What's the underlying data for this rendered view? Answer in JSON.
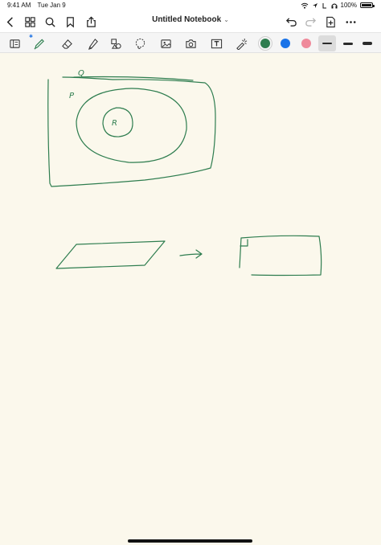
{
  "status_bar": {
    "time": "9:41 AM",
    "date": "Tue Jan 9",
    "battery": "100%",
    "battery_level": 1.0
  },
  "nav": {
    "title": "Untitled Notebook",
    "title_chevron": "⌄",
    "left_icons": [
      "back-icon",
      "grid-icon",
      "search-icon",
      "bookmark-icon",
      "share-icon"
    ],
    "right_icons": [
      "undo-icon",
      "redo-icon",
      "add-page-icon",
      "more-icon"
    ]
  },
  "toolbar": {
    "tools": [
      "page-view-icon",
      "pen-icon",
      "eraser-icon",
      "highlighter-icon",
      "shapes-icon",
      "lasso-icon",
      "image-icon",
      "camera-icon",
      "text-icon",
      "laser-icon"
    ],
    "selected_tool": "pen-icon",
    "bluetooth_indicator": "bluetooth-icon",
    "colors": [
      "#2e7d4f",
      "#1a73e8",
      "#ef8a9b"
    ],
    "selected_color": "#2e7d4f",
    "thicknesses": [
      "thin",
      "medium",
      "thick"
    ],
    "selected_thickness": "thin"
  },
  "canvas": {
    "background": "#fbf8ec",
    "ink_color": "#2e7d4f",
    "labels": {
      "q": "Q",
      "p": "P",
      "r": "R"
    }
  }
}
